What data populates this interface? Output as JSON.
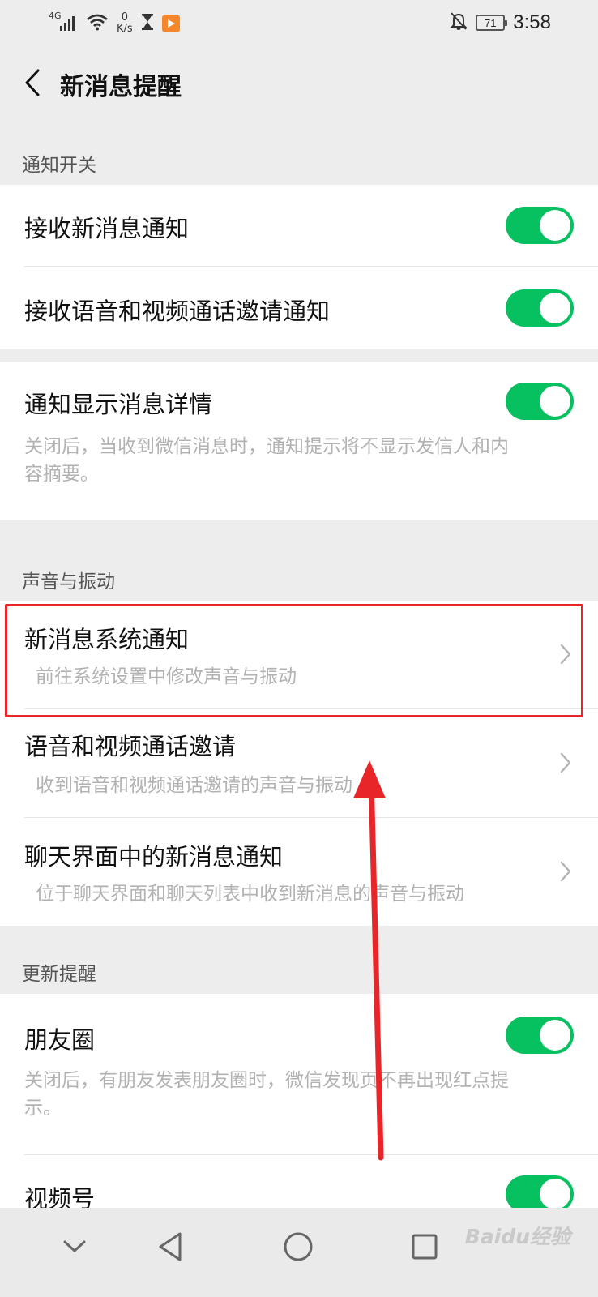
{
  "status_bar": {
    "network_label": "4G",
    "speed_value": "0",
    "speed_unit": "K/s",
    "battery": "71",
    "time": "3:58"
  },
  "header": {
    "title": "新消息提醒"
  },
  "sections": {
    "notify_switch": {
      "header": "通知开关"
    },
    "sound_vibration": {
      "header": "声音与振动"
    },
    "update_reminder": {
      "header": "更新提醒"
    }
  },
  "notify_switch_items": {
    "receive_new_msg": {
      "label": "接收新消息通知",
      "enabled": true
    },
    "receive_call_invite": {
      "label": "接收语音和视频通话邀请通知",
      "enabled": true
    }
  },
  "details_item": {
    "label": "通知显示消息详情",
    "desc_line1": "关闭后，当收到微信消息时，通知提示将不显示发信人和内",
    "desc_line2": "容摘要。",
    "enabled": true
  },
  "sound_items": {
    "system_notification": {
      "label": "新消息系统通知",
      "desc": "前往系统设置中修改声音与振动"
    },
    "call_invite": {
      "label": "语音和视频通话邀请",
      "desc": "收到语音和视频通话邀请的声音与振动"
    },
    "chat_notification": {
      "label": "聊天界面中的新消息通知",
      "desc": "位于聊天界面和聊天列表中收到新消息的声音与振动"
    }
  },
  "update_items": {
    "moments": {
      "label": "朋友圈",
      "desc_line1": "关闭后，有朋友发表朋友圈时，微信发现页不再出现红点提",
      "desc_line2": "示。",
      "enabled": true
    },
    "channels": {
      "label": "视频号",
      "enabled": true
    }
  },
  "watermark": "Baidu经验",
  "colors": {
    "toggle_on": "#07c160",
    "highlight": "#e8262a",
    "arrow": "#e8262a"
  }
}
